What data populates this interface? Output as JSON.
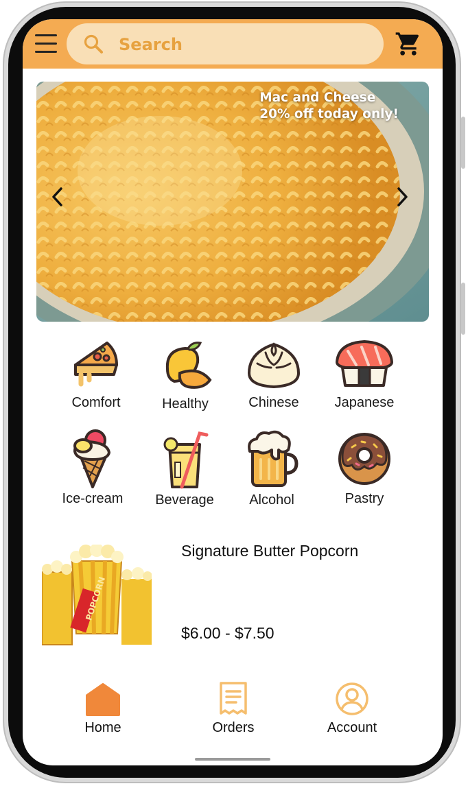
{
  "header": {
    "menu_icon": "hamburger-menu-icon",
    "search_placeholder": "Search",
    "search_value": "",
    "cart_icon": "shopping-cart-icon",
    "colors": {
      "bar": "#f4ab52",
      "search_bg": "#f9dfb6",
      "search_text": "#e7a240"
    }
  },
  "banner": {
    "line1": "Mac and Cheese",
    "line2": "20% off today only!",
    "prev_icon": "chevron-left-icon",
    "next_icon": "chevron-right-icon"
  },
  "categories": [
    {
      "label": "Comfort",
      "icon": "pizza-slice-icon"
    },
    {
      "label": "Healthy",
      "icon": "mango-icon"
    },
    {
      "label": "Chinese",
      "icon": "bao-bun-icon"
    },
    {
      "label": "Japanese",
      "icon": "sushi-icon"
    },
    {
      "label": "Ice-cream",
      "icon": "ice-cream-cone-icon"
    },
    {
      "label": "Beverage",
      "icon": "lemonade-glass-icon"
    },
    {
      "label": "Alcohol",
      "icon": "beer-mug-icon"
    },
    {
      "label": "Pastry",
      "icon": "donut-icon"
    }
  ],
  "product": {
    "name": "Signature Butter Popcorn",
    "price": "$6.00 - $7.50",
    "image_text": "POPCORN"
  },
  "tabs": [
    {
      "label": "Home",
      "icon": "home-icon",
      "active": true
    },
    {
      "label": "Orders",
      "icon": "receipt-icon",
      "active": false
    },
    {
      "label": "Account",
      "icon": "user-circle-icon",
      "active": false
    }
  ],
  "accent": "#f0883a"
}
